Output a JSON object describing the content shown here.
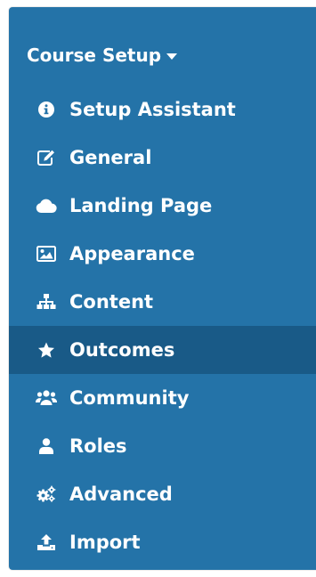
{
  "panel": {
    "title": "Course Setup",
    "bg_color": "#2473a8",
    "active_bg_color": "#195a87"
  },
  "menu": {
    "items": [
      {
        "label": "Setup Assistant",
        "icon": "info-circle-icon"
      },
      {
        "label": "General",
        "icon": "edit-icon"
      },
      {
        "label": "Landing Page",
        "icon": "cloud-icon"
      },
      {
        "label": "Appearance",
        "icon": "image-icon"
      },
      {
        "label": "Content",
        "icon": "sitemap-icon"
      },
      {
        "label": "Outcomes",
        "icon": "star-icon",
        "active": true
      },
      {
        "label": "Community",
        "icon": "users-icon"
      },
      {
        "label": "Roles",
        "icon": "user-icon"
      },
      {
        "label": "Advanced",
        "icon": "gears-icon"
      },
      {
        "label": "Import",
        "icon": "upload-icon"
      }
    ]
  }
}
